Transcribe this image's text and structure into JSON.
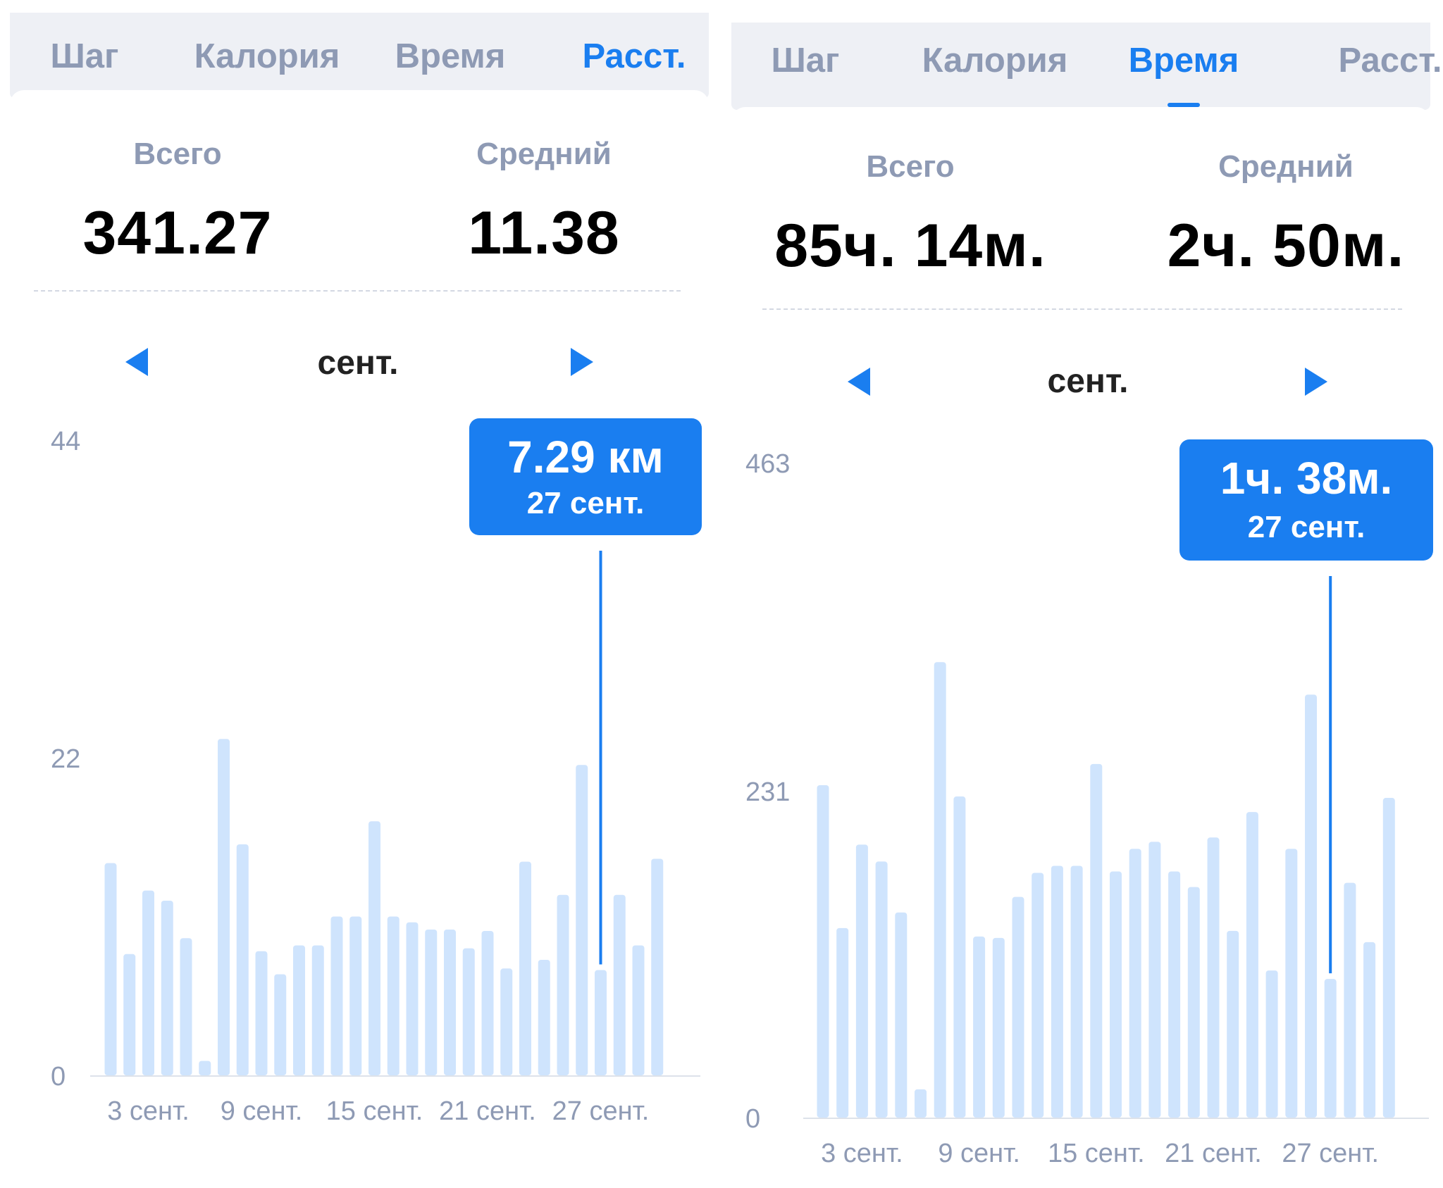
{
  "colors": {
    "accent": "#1a7ef0",
    "tab_inactive": "#8e9ab4",
    "tabbar_bg": "#eef0f5",
    "bar": "#cfe4fd",
    "axis_text": "#8e9ab4"
  },
  "icons": {
    "prev": "triangle-left-icon",
    "next": "triangle-right-icon"
  },
  "panels": [
    {
      "tabs": [
        {
          "label": "Шаг",
          "active": false
        },
        {
          "label": "Калория",
          "active": false
        },
        {
          "label": "Время",
          "active": false
        },
        {
          "label": "Расст.",
          "active": true
        }
      ],
      "stats": {
        "total_label": "Всего",
        "total_value": "341.27",
        "average_label": "Средний",
        "average_value": "11.38"
      },
      "month": "сент.",
      "tooltip": {
        "value": "7.29 км",
        "date": "27 сент."
      }
    },
    {
      "tabs": [
        {
          "label": "Шаг",
          "active": false
        },
        {
          "label": "Калория",
          "active": false
        },
        {
          "label": "Время",
          "active": true
        },
        {
          "label": "Расст.",
          "active": false
        }
      ],
      "stats": {
        "total_label": "Всего",
        "total_value": "85ч. 14м.",
        "average_label": "Средний",
        "average_value": "2ч. 50м."
      },
      "month": "сент.",
      "tooltip": {
        "value": "1ч. 38м.",
        "date": "27 сент."
      }
    }
  ],
  "chart_data": [
    {
      "type": "bar",
      "x": [
        1,
        2,
        3,
        4,
        5,
        6,
        7,
        8,
        9,
        10,
        11,
        12,
        13,
        14,
        15,
        16,
        17,
        18,
        19,
        20,
        21,
        22,
        23,
        24,
        25,
        26,
        27,
        28,
        29,
        30
      ],
      "values": [
        14.7,
        8.4,
        12.8,
        12.1,
        9.5,
        1.0,
        23.3,
        16.0,
        8.6,
        7.0,
        9.0,
        9.0,
        11.0,
        11.0,
        17.6,
        11.0,
        10.6,
        10.1,
        10.1,
        8.8,
        10.0,
        7.4,
        14.8,
        8.0,
        12.5,
        21.5,
        7.29,
        12.5,
        9.0,
        15.0
      ],
      "y_ticks": [
        "0",
        "22",
        "44"
      ],
      "x_ticks": [
        "3 сент.",
        "9 сент.",
        "15 сент.",
        "21 сент.",
        "27 сент."
      ],
      "x_tick_days": [
        3,
        9,
        15,
        21,
        27
      ],
      "ylim": [
        0,
        44
      ],
      "highlight_day": 27,
      "grid": false
    },
    {
      "type": "bar",
      "x": [
        1,
        2,
        3,
        4,
        5,
        6,
        7,
        8,
        9,
        10,
        11,
        12,
        13,
        14,
        15,
        16,
        17,
        18,
        19,
        20,
        21,
        22,
        23,
        24,
        25,
        26,
        27,
        28,
        29,
        30
      ],
      "values": [
        235,
        134,
        193,
        181,
        145,
        20,
        322,
        227,
        128,
        127,
        156,
        173,
        178,
        178,
        250,
        174,
        190,
        195,
        174,
        163,
        198,
        132,
        216,
        104,
        190,
        299,
        98,
        166,
        124,
        226
      ],
      "y_ticks": [
        "0",
        "231",
        "463"
      ],
      "x_ticks": [
        "3 сент.",
        "9 сент.",
        "15 сент.",
        "21 сент.",
        "27 сент."
      ],
      "x_tick_days": [
        3,
        9,
        15,
        21,
        27
      ],
      "ylim": [
        0,
        463
      ],
      "highlight_day": 27,
      "grid": false
    }
  ]
}
